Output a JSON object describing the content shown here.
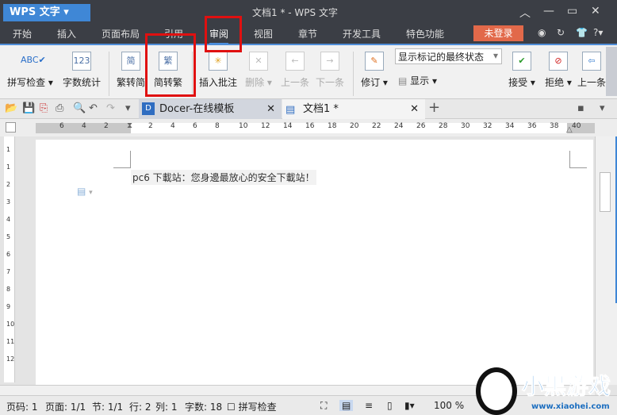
{
  "app": {
    "name": "WPS 文字",
    "doc_title": "文档1 * - WPS 文字"
  },
  "menu": [
    "开始",
    "插入",
    "页面布局",
    "引用",
    "审阅",
    "视图",
    "章节",
    "开发工具",
    "特色功能"
  ],
  "login": "未登录",
  "ribbon": {
    "spell": "拼写检查",
    "wordcount": "字数统计",
    "t2s": "繁转简",
    "s2t": "简转繁",
    "insert_comment": "插入批注",
    "delete": "删除",
    "prev": "上一条",
    "next": "下一条",
    "revise": "修订",
    "show": "显示",
    "markup_select": "显示标记的最终状态",
    "accept": "接受",
    "reject": "拒绝",
    "prev2": "上一条"
  },
  "tabs": [
    {
      "label": "Docer-在线模板"
    },
    {
      "label": "文档1 *"
    }
  ],
  "ruler": [
    "6",
    "4",
    "2",
    "2",
    "4",
    "6",
    "8",
    "10",
    "12",
    "14",
    "16",
    "18",
    "20",
    "22",
    "24",
    "26",
    "28",
    "30",
    "32",
    "34",
    "36",
    "38",
    "40"
  ],
  "vruler": [
    "1",
    "1",
    "2",
    "3",
    "4",
    "5",
    "6",
    "7",
    "8",
    "9",
    "10",
    "11",
    "12"
  ],
  "content": "pc6 下載站：您身邊最放心的安全下載站！",
  "status": {
    "page": "页码: 1",
    "pages": "页面: 1/1",
    "section": "节: 1/1",
    "row": "行: 2",
    "col": "列: 1",
    "words": "字数: 18",
    "spell": "拼写检查",
    "zoom": "100 %"
  },
  "watermark": {
    "text": "小黑游戏",
    "url": "www.xiaohei.com"
  }
}
